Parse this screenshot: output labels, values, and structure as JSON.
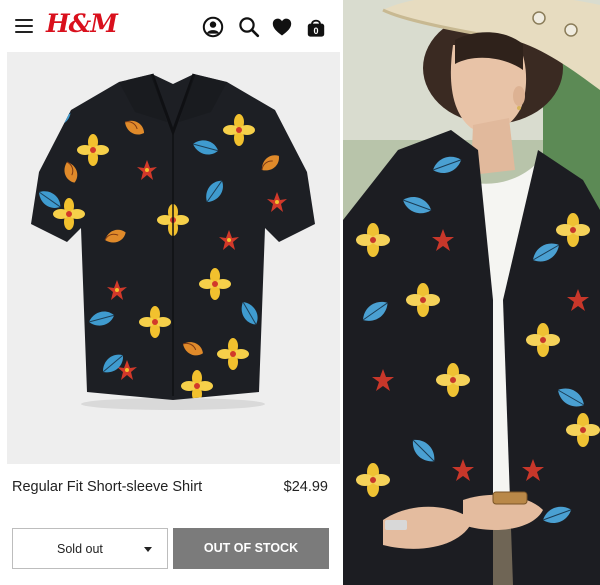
{
  "header": {
    "logo_text": "H&M",
    "icons": [
      "menu-icon",
      "account-icon",
      "search-icon",
      "heart-icon",
      "shopping-bag-icon"
    ],
    "cart_count": "0",
    "brand_color": "#d9101d"
  },
  "product": {
    "title": "Regular Fit Short-sleeve Shirt",
    "price": "$24.99"
  },
  "size_select": {
    "selected": "Sold out"
  },
  "actions": {
    "out_of_stock_label": "OUT OF STOCK"
  },
  "colors": {
    "button_gray": "#7b7b7b",
    "product_bg": "#eeeeee",
    "shirt_base": "#1d1f24",
    "flower_yellow": "#f2c12e",
    "leaf_blue": "#3f9bcf",
    "flower_red": "#d2392a"
  }
}
